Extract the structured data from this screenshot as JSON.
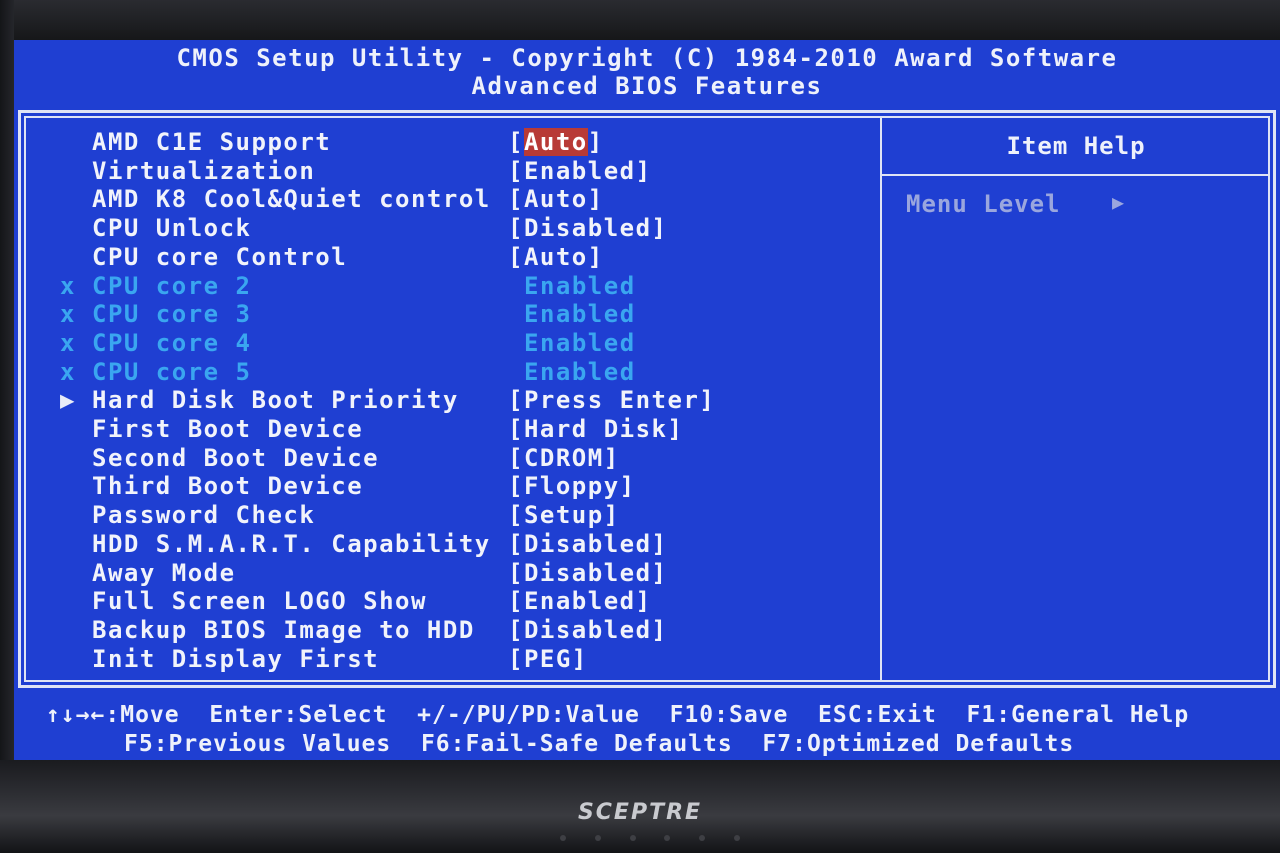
{
  "header": {
    "line1": "CMOS Setup Utility - Copyright (C) 1984-2010 Award Software",
    "line2": "Advanced BIOS Features"
  },
  "settings": [
    {
      "marker": "",
      "label": "AMD C1E Support",
      "value": "[Auto]",
      "state": "selected"
    },
    {
      "marker": "",
      "label": "Virtualization",
      "value": "[Enabled]",
      "state": "normal"
    },
    {
      "marker": "",
      "label": "AMD K8 Cool&Quiet control",
      "value": "[Auto]",
      "state": "normal"
    },
    {
      "marker": "",
      "label": "CPU Unlock",
      "value": "[Disabled]",
      "state": "normal"
    },
    {
      "marker": "",
      "label": "CPU core Control",
      "value": "[Auto]",
      "state": "normal"
    },
    {
      "marker": "x",
      "label": "CPU core 2",
      "value": "Enabled",
      "state": "disabled"
    },
    {
      "marker": "x",
      "label": "CPU core 3",
      "value": "Enabled",
      "state": "disabled"
    },
    {
      "marker": "x",
      "label": "CPU core 4",
      "value": "Enabled",
      "state": "disabled"
    },
    {
      "marker": "x",
      "label": "CPU core 5",
      "value": "Enabled",
      "state": "disabled"
    },
    {
      "marker": "▶",
      "label": "Hard Disk Boot Priority",
      "value": "[Press Enter]",
      "state": "normal"
    },
    {
      "marker": "",
      "label": "First Boot Device",
      "value": "[Hard Disk]",
      "state": "normal"
    },
    {
      "marker": "",
      "label": "Second Boot Device",
      "value": "[CDROM]",
      "state": "normal"
    },
    {
      "marker": "",
      "label": "Third Boot Device",
      "value": "[Floppy]",
      "state": "normal"
    },
    {
      "marker": "",
      "label": "Password Check",
      "value": "[Setup]",
      "state": "normal"
    },
    {
      "marker": "",
      "label": "HDD S.M.A.R.T. Capability",
      "value": "[Disabled]",
      "state": "normal"
    },
    {
      "marker": "",
      "label": "Away Mode",
      "value": "[Disabled]",
      "state": "normal"
    },
    {
      "marker": "",
      "label": "Full Screen LOGO Show",
      "value": "[Enabled]",
      "state": "normal"
    },
    {
      "marker": "",
      "label": "Backup BIOS Image to HDD",
      "value": "[Disabled]",
      "state": "normal"
    },
    {
      "marker": "",
      "label": "Init Display First",
      "value": "[PEG]",
      "state": "normal"
    }
  ],
  "help_panel": {
    "title": "Item Help",
    "menu_level_label": "Menu Level",
    "menu_level_arrow": "▶"
  },
  "footer": {
    "line1": "↑↓→←:Move  Enter:Select  +/-/PU/PD:Value  F10:Save  ESC:Exit  F1:General Help",
    "line2": "F5:Previous Values  F6:Fail-Safe Defaults  F7:Optimized Defaults"
  },
  "monitor": {
    "brand": "SCEPTRE"
  },
  "colors": {
    "background": "#1f3fd2",
    "text": "#f1f3fb",
    "disabled_text": "#3aa6f0",
    "selection": "#b83a36"
  }
}
